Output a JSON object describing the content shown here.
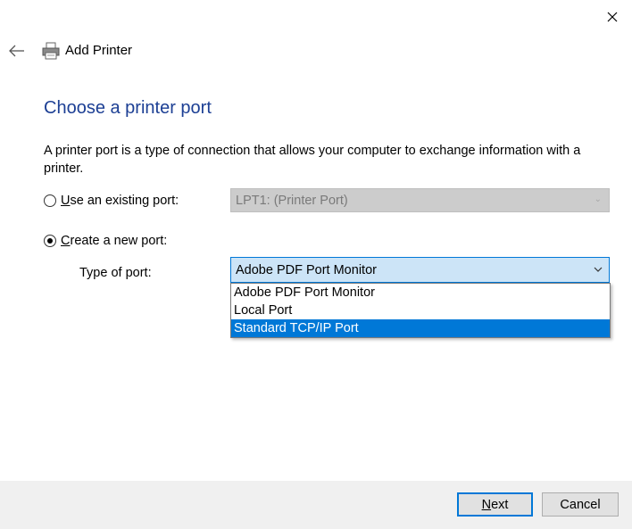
{
  "window": {
    "title": "Add Printer",
    "close_icon": "close-icon",
    "back_icon": "back-arrow-icon",
    "app_icon": "printer-icon"
  },
  "page": {
    "heading": "Choose a printer port",
    "description": "A printer port is a type of connection that allows your computer to exchange information with a printer."
  },
  "options": {
    "existing": {
      "mnemonic": "U",
      "label_rest": "se an existing port:",
      "selected": false,
      "value": "LPT1: (Printer Port)"
    },
    "new_port": {
      "mnemonic": "C",
      "label_rest": "reate a new port:",
      "selected": true
    }
  },
  "type_of_port": {
    "label": "Type of port:",
    "value": "Adobe PDF Port Monitor",
    "options": [
      "Adobe PDF Port Monitor",
      "Local Port",
      "Standard TCP/IP Port"
    ],
    "highlighted": "Standard TCP/IP Port"
  },
  "footer": {
    "next_mnemonic": "N",
    "next_rest": "ext",
    "cancel": "Cancel"
  },
  "colors": {
    "heading": "#1c3f94",
    "accent": "#0078d7",
    "highlight_bg": "#0078d7",
    "combo_focus_bg": "#cce4f7",
    "footer_bg": "#f0f0f0"
  }
}
